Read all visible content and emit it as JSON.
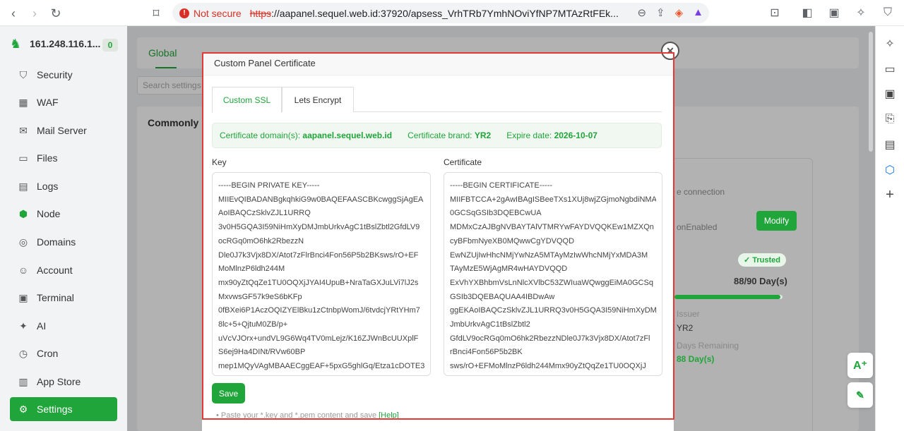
{
  "browser": {
    "not_secure": "Not secure",
    "url_scheme": "https",
    "url_rest": "://aapanel.sequel.web.id:37920/apsess_VrhTRb7YmhNOviYfNP7MTAzRtFEk..."
  },
  "sidebar": {
    "server_ip": "161.248.116.1...",
    "badge": "0",
    "items": [
      {
        "label": "Security",
        "icon": "shield-icon"
      },
      {
        "label": "WAF",
        "icon": "waf-icon"
      },
      {
        "label": "Mail Server",
        "icon": "mail-icon"
      },
      {
        "label": "Files",
        "icon": "folder-icon"
      },
      {
        "label": "Logs",
        "icon": "logs-icon"
      },
      {
        "label": "Node",
        "icon": "node-icon"
      },
      {
        "label": "Domains",
        "icon": "globe-icon"
      },
      {
        "label": "Account",
        "icon": "user-icon"
      },
      {
        "label": "Terminal",
        "icon": "terminal-icon"
      },
      {
        "label": "AI",
        "icon": "sparkle-icon"
      },
      {
        "label": "Cron",
        "icon": "clock-icon"
      },
      {
        "label": "App Store",
        "icon": "store-icon"
      },
      {
        "label": "Settings",
        "icon": "gear-icon"
      }
    ]
  },
  "background": {
    "tab_global": "Global",
    "search_placeholder": "Search settings",
    "section_title": "Commonly",
    "connection_text": "e connection",
    "enabled_text": "onEnabled",
    "modify": "Modify",
    "trusted": "Trusted",
    "days": "88/90 Day(s)",
    "days_fraction": 0.978,
    "issuer_label": "Issuer",
    "issuer_value": "YR2",
    "remaining_label": "Days Remaining",
    "remaining_value": "88 Day(s)"
  },
  "modal": {
    "title": "Custom Panel Certificate",
    "tabs": [
      "Custom SSL",
      "Lets Encrypt"
    ],
    "info": {
      "domain_label": "Certificate domain(s):",
      "domain_value": "aapanel.sequel.web.id",
      "brand_label": "Certificate brand:",
      "brand_value": "YR2",
      "expire_label": "Expire date:",
      "expire_value": "2026-10-07"
    },
    "key_label": "Key",
    "cert_label": "Certificate",
    "key_lines": [
      "-----BEGIN PRIVATE KEY-----",
      "MIIEvQIBADANBgkqhkiG9w0BAQEFAASCBKcwggSjAgEA",
      "AoIBAQCzSklvZJL1URRQ",
      "3v0H5GQA3I59NiHmXyDMJmbUrkvAgC1tBslZbtl2GfdLV9",
      "ocRGq0mO6hk2RbezzN",
      "Dle0J7k3Vjx8DX/Atot7zFlrBnci4Fon56P5b2BKsws/rO+EF",
      "MoMlnzP6ldh244M",
      "mx90yZtQqZe1TU0OQXjJYAI4UpuB+NraTaGXJuLVi7lJ2s",
      "MxvwsGF57k9eS6bKFp",
      "0fBXei6P1AczOQIZYElBku1zCtnbpWomJ/6tvdcjYRtYHm7",
      "8lc+5+QjtuM0ZB/p+",
      "uVcVJOrx+undVL9G6Wq4TV0mLejz/K16ZJWnBcUUXplF",
      "S6ej9Ha4DINt/RVw60BP",
      "mep1MQyVAgMBAAECggEAF+5pxG5ghlGq/Etza1cDOTE3"
    ],
    "cert_lines": [
      "-----BEGIN CERTIFICATE-----",
      "MIIFBTCCA+2gAwIBAgISBeeTXs1XUj8wjZGjmoNgbdiNMA",
      "0GCSqGSIb3DQEBCwUA",
      "MDMxCzAJBgNVBAYTAlVTMRYwFAYDVQQKEw1MZXQn",
      "cyBFbmNyeXB0MQwwCgYDVQQD",
      "EwNZUjIwHhcNMjYwNzA5MTAyMzIwWhcNMjYxMDA3M",
      "TAyMzE5WjAgMR4wHAYDVQQD",
      "ExVhYXBhbmVsLnNlcXVlbC53ZWIuaWQwggEiMA0GCSq",
      "GSIb3DQEBAQUAA4IBDwAw",
      "ggEKAoIBAQCzSklvZJL1URRQ3v0H5GQA3I59NiHmXyDM",
      "JmbUrkvAgC1tBslZbtl2",
      "GfdLV9ocRGq0mO6hk2RbezzNDle0J7k3Vjx8DX/Atot7zFl",
      "rBnci4Fon56P5b2BK",
      "sws/rO+EFMoMlnzP6ldh244Mmx90yZtQqZe1TU0OQXjJ"
    ],
    "save": "Save",
    "help_text": "Paste your *.key and *.pem content and save",
    "help_link": "[Help]"
  }
}
